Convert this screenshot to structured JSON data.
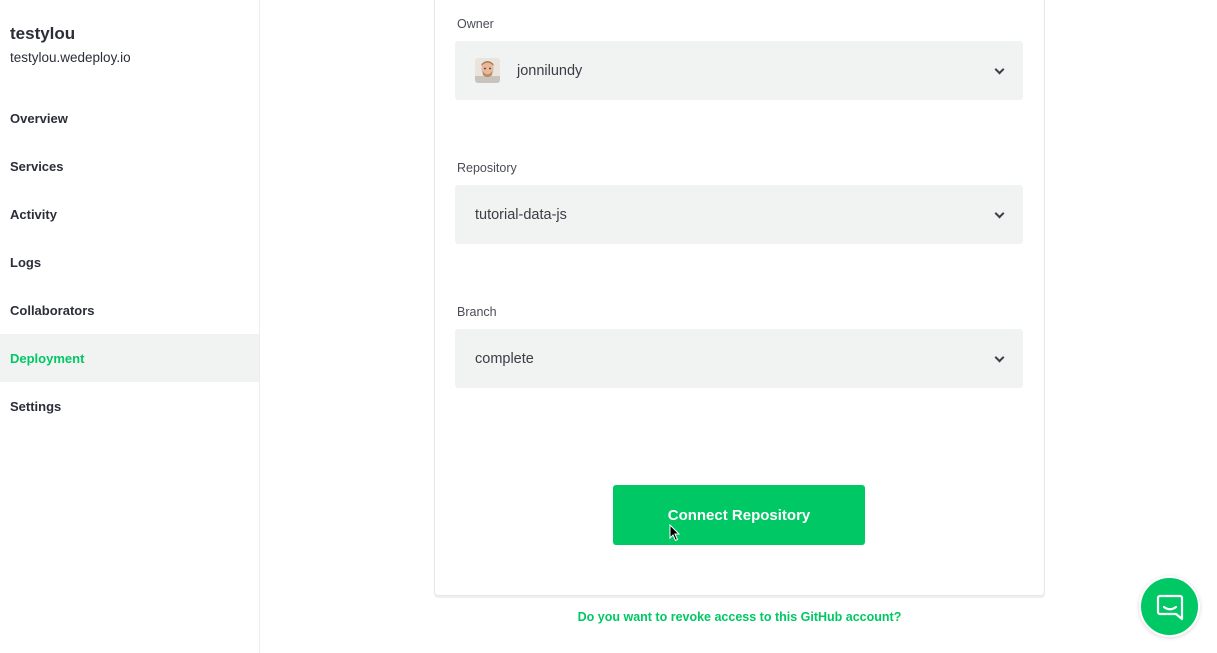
{
  "project": {
    "name": "testylou",
    "domain": "testylou.wedeploy.io"
  },
  "sidebar": {
    "items": [
      {
        "label": "Overview",
        "active": false
      },
      {
        "label": "Services",
        "active": false
      },
      {
        "label": "Activity",
        "active": false
      },
      {
        "label": "Logs",
        "active": false
      },
      {
        "label": "Collaborators",
        "active": false
      },
      {
        "label": "Deployment",
        "active": true
      },
      {
        "label": "Settings",
        "active": false
      }
    ]
  },
  "form": {
    "owner": {
      "label": "Owner",
      "value": "jonnilundy",
      "icon": "chevron-down-icon"
    },
    "repository": {
      "label": "Repository",
      "value": "tutorial-data-js",
      "icon": "chevron-down-icon"
    },
    "branch": {
      "label": "Branch",
      "value": "complete",
      "icon": "chevron-down-icon"
    },
    "submit_label": "Connect Repository",
    "revoke_link": "Do you want to revoke access to this GitHub account?"
  },
  "colors": {
    "accent": "#00c864",
    "field_bg": "#f1f2f2",
    "text": "#2b2e38"
  },
  "chat": {
    "icon": "chat-icon"
  }
}
